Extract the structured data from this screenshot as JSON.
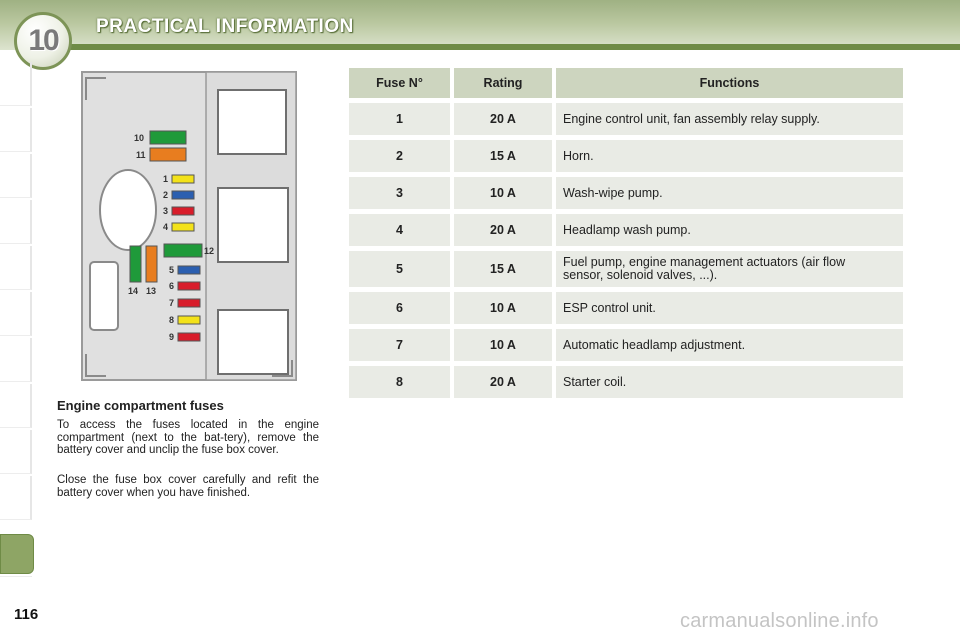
{
  "header": {
    "chapter_number": "10",
    "title": "PRACTICAL INFORMATION"
  },
  "figure": {
    "labels": [
      "10",
      "11",
      "1",
      "2",
      "3",
      "4",
      "12",
      "5",
      "6",
      "7",
      "8",
      "9",
      "14",
      "13"
    ],
    "colors": {
      "green": "#1f9a3a",
      "orange": "#e87d1f",
      "yellow": "#f3e21a",
      "blue": "#2b5fb0",
      "red": "#d81d2b"
    }
  },
  "section": {
    "title": "Engine compartment fuses",
    "paragraph_1": "To access the fuses located in the engine compartment (next to the bat-tery), remove the battery cover and unclip the fuse box cover.",
    "paragraph_2": "Close the fuse box cover carefully and refit the battery cover when you have finished."
  },
  "table": {
    "headers": [
      "Fuse N°",
      "Rating",
      "Functions"
    ],
    "rows": [
      {
        "fuse": "1",
        "rating": "20 A",
        "function": "Engine control unit, fan assembly relay supply."
      },
      {
        "fuse": "2",
        "rating": "15 A",
        "function": "Horn."
      },
      {
        "fuse": "3",
        "rating": "10 A",
        "function": "Wash-wipe pump."
      },
      {
        "fuse": "4",
        "rating": "20 A",
        "function": "Headlamp wash pump."
      },
      {
        "fuse": "5",
        "rating": "15 A",
        "function": "Fuel pump, engine management actuators (air flow sensor, solenoid valves, ...)."
      },
      {
        "fuse": "6",
        "rating": "10 A",
        "function": "ESP control unit."
      },
      {
        "fuse": "7",
        "rating": "10 A",
        "function": "Automatic headlamp adjustment."
      },
      {
        "fuse": "8",
        "rating": "20 A",
        "function": "Starter coil."
      }
    ]
  },
  "footer": {
    "page_number": "116",
    "watermark": "carmanualsonline.info"
  }
}
